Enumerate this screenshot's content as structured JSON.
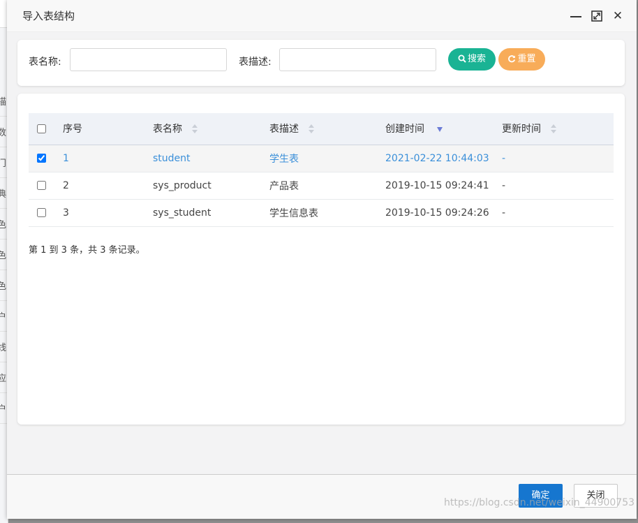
{
  "background_page": {
    "sidebar_fragments": [
      "描",
      "数",
      "门",
      "典",
      "色",
      "色",
      "色",
      "户",
      "线",
      "应",
      "户"
    ]
  },
  "dialog": {
    "title": "导入表结构",
    "search": {
      "table_name_label": "表名称:",
      "table_name_value": "",
      "table_desc_label": "表描述:",
      "table_desc_value": "",
      "search_button": "搜索",
      "reset_button": "重置"
    },
    "table": {
      "headers": {
        "index": "序号",
        "table_name": "表名称",
        "table_desc": "表描述",
        "create_time": "创建时间",
        "update_time": "更新时间"
      },
      "sorted_column": "create_time",
      "sort_order": "desc",
      "rows": [
        {
          "checked": true,
          "index": "1",
          "table_name": "student",
          "table_desc": "学生表",
          "create_time": "2021-02-22 10:44:03",
          "update_time": "-"
        },
        {
          "checked": false,
          "index": "2",
          "table_name": "sys_product",
          "table_desc": "产品表",
          "create_time": "2019-10-15 09:24:41",
          "update_time": "-"
        },
        {
          "checked": false,
          "index": "3",
          "table_name": "sys_student",
          "table_desc": "学生信息表",
          "create_time": "2019-10-15 09:24:26",
          "update_time": "-"
        }
      ],
      "summary": "第 1 到 3 条，共 3 条记录。"
    },
    "footer": {
      "confirm_button": "确定",
      "close_button": "关闭"
    }
  },
  "watermark": "https://blog.csdn.net/weixin_44900753",
  "colors": {
    "search_button": "#1ab394",
    "reset_button": "#f8ac59",
    "confirm_button": "#1676cf",
    "selected_text": "#3a8fd9",
    "sort_active": "#6b7bd6"
  }
}
